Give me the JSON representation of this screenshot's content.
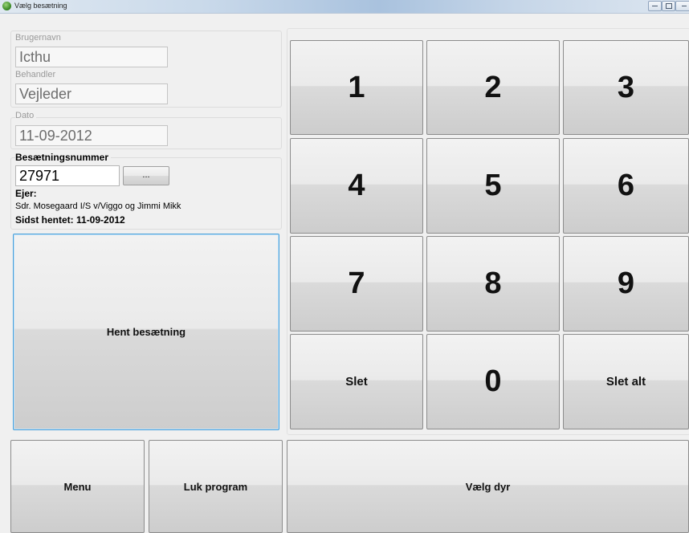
{
  "window": {
    "title": "Vælg besætning"
  },
  "fields": {
    "username_label": "Brugernavn",
    "username_value": "Icthu",
    "handler_label": "Behandler",
    "handler_value": "Vejleder",
    "date_label": "Dato",
    "date_value": "11-09-2012",
    "herd_label": "Besætningsnummer",
    "herd_value": "27971",
    "browse_label": "...",
    "owner_label": "Ejer:",
    "owner_value": "Sdr. Mosegaard I/S v/Viggo og Jimmi Mikk",
    "last_fetched": "Sidst hentet: 11-09-2012"
  },
  "actions": {
    "fetch_herd": "Hent besætning",
    "menu": "Menu",
    "close_program": "Luk program",
    "choose_animal": "Vælg dyr"
  },
  "keypad": {
    "k1": "1",
    "k2": "2",
    "k3": "3",
    "k4": "4",
    "k5": "5",
    "k6": "6",
    "k7": "7",
    "k8": "8",
    "k9": "9",
    "delete": "Slet",
    "k0": "0",
    "delete_all": "Slet alt"
  }
}
